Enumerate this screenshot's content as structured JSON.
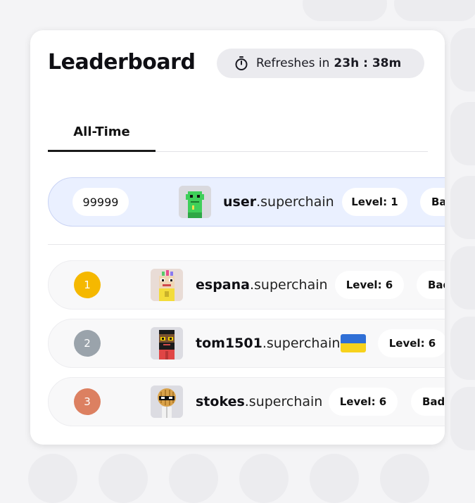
{
  "header": {
    "title": "Leaderboard",
    "refresh_prefix": "Refreshes in",
    "refresh_time": "23h : 38m"
  },
  "tabs": [
    {
      "label": "All-Time",
      "active": true
    }
  ],
  "current_user": {
    "score": "99999",
    "handle": "user",
    "domain": ".superchain",
    "level": "Level: 1",
    "badge_partial": "Ba"
  },
  "leaders": [
    {
      "rank": "1",
      "rank_color": "#f5b800",
      "handle": "espana",
      "domain": ".superchain",
      "level": "Level: 6",
      "badge_partial": "Bad"
    },
    {
      "rank": "2",
      "rank_color": "#9aa3ab",
      "handle": "tom1501",
      "domain": ".superchain",
      "flag": "ukraine-flag",
      "flag_colors": [
        "#2f6fd6",
        "#f7d21c"
      ],
      "level": "Level: 6"
    },
    {
      "rank": "3",
      "rank_color": "#dc8061",
      "handle": "stokes",
      "domain": ".superchain",
      "level": "Level: 6",
      "badge_partial": "Bad"
    }
  ],
  "icons": {
    "timer": "timer-icon"
  }
}
